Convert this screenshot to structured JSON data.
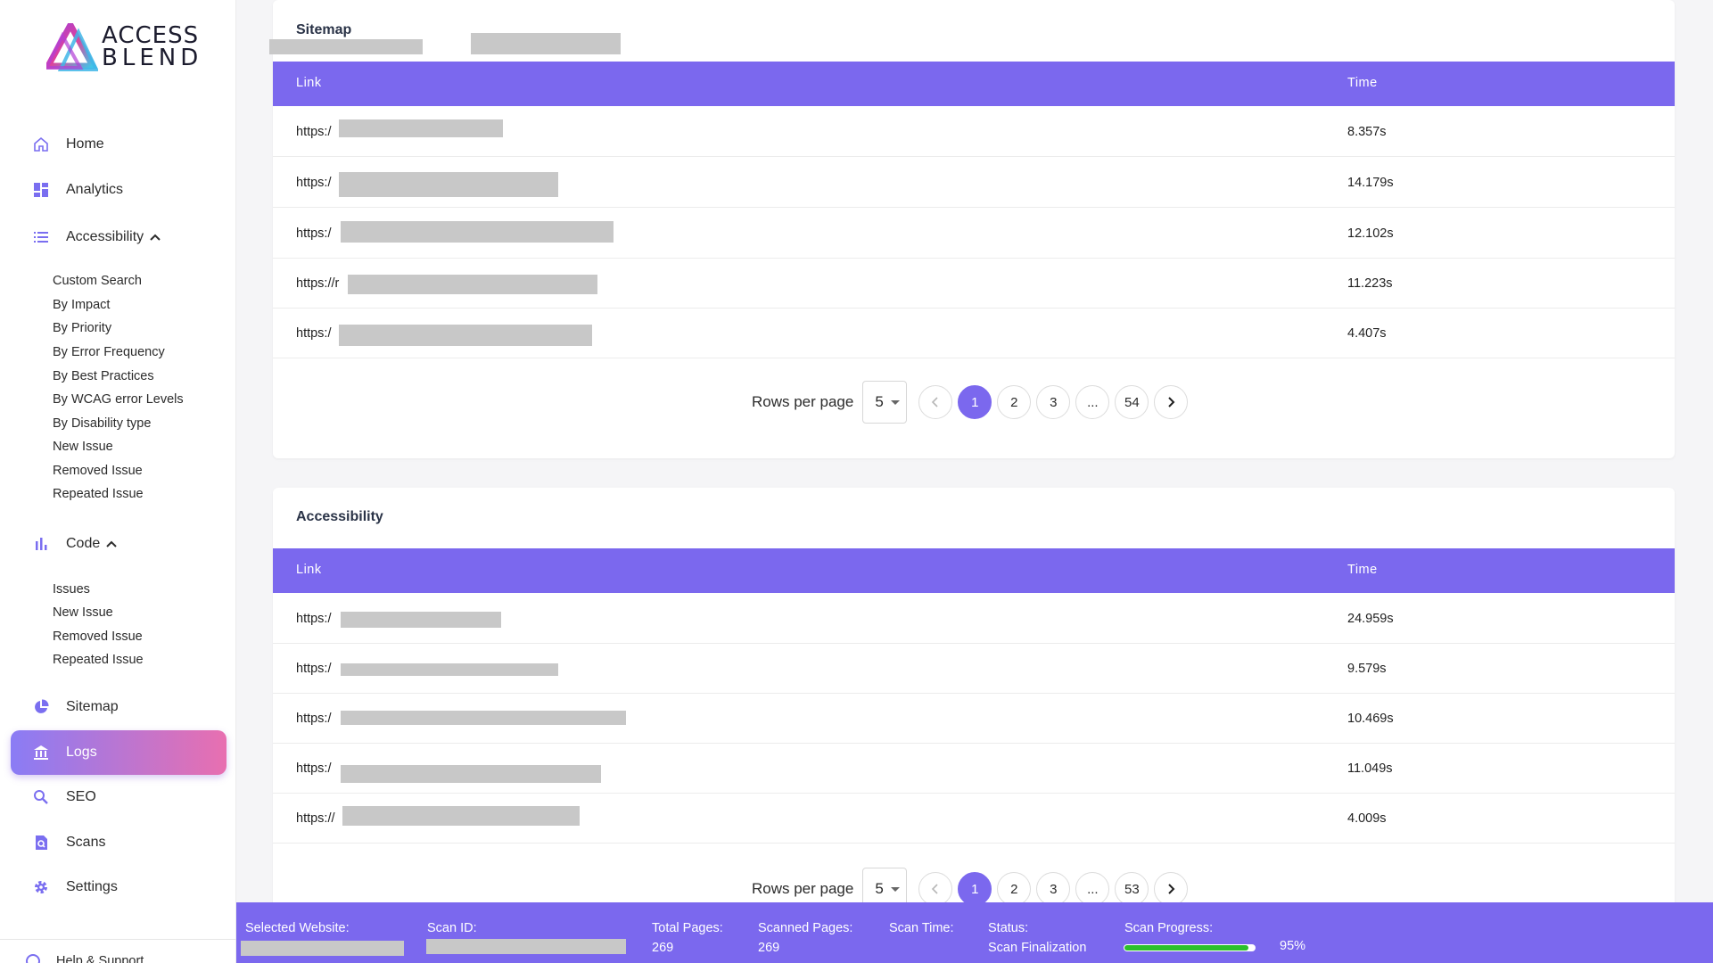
{
  "brand": {
    "line1": "ACCESS",
    "line2": "BLEND"
  },
  "nav": {
    "home": "Home",
    "analytics": "Analytics",
    "accessibility": "Accessibility",
    "accessibility_sub": [
      "Custom Search",
      "By Impact",
      "By Priority",
      "By Error Frequency",
      "By Best Practices",
      "By WCAG error Levels",
      "By Disability type",
      "New Issue",
      "Removed Issue",
      "Repeated Issue"
    ],
    "code": "Code",
    "code_sub": [
      "Issues",
      "New Issue",
      "Removed Issue",
      "Repeated Issue"
    ],
    "sitemap": "Sitemap",
    "logs": "Logs",
    "seo": "SEO",
    "scans": "Scans",
    "settings": "Settings",
    "help": "Help & Support"
  },
  "sitemap_table": {
    "title": "Sitemap",
    "columns": [
      "Link",
      "Time"
    ],
    "rows": [
      {
        "link": "https:/",
        "time": "8.357s"
      },
      {
        "link": "https:/",
        "time": "14.179s"
      },
      {
        "link": "https:/",
        "time": "12.102s"
      },
      {
        "link": "https://r",
        "time": "11.223s"
      },
      {
        "link": "https:/",
        "time": "4.407s"
      }
    ],
    "rows_per_page_label": "Rows per page",
    "rows_per_page": "5",
    "pages": [
      "1",
      "2",
      "3",
      "...",
      "54"
    ],
    "current_page": "1"
  },
  "accessibility_table": {
    "title": "Accessibility",
    "columns": [
      "Link",
      "Time"
    ],
    "rows": [
      {
        "link": "https:/",
        "time": "24.959s"
      },
      {
        "link": "https:/",
        "time": "9.579s"
      },
      {
        "link": "https:/",
        "time": "10.469s"
      },
      {
        "link": "https:/",
        "time": "11.049s"
      },
      {
        "link": "https://",
        "time": "4.009s"
      }
    ],
    "rows_per_page_label": "Rows per page",
    "rows_per_page": "5",
    "pages": [
      "1",
      "2",
      "3",
      "...",
      "53"
    ],
    "current_page": "1"
  },
  "status": {
    "selected_website_label": "Selected Website:",
    "scan_id_label": "Scan ID:",
    "total_pages_label": "Total Pages:",
    "total_pages": "269",
    "scanned_pages_label": "Scanned Pages:",
    "scanned_pages": "269",
    "scan_time_label": "Scan Time:",
    "status_label": "Status:",
    "status_value": "Scan Finalization",
    "scan_progress_label": "Scan Progress:",
    "scan_progress_text": "95%",
    "scan_progress": 0.95,
    "progress_color": "#2bc02b"
  },
  "colors": {
    "accent": "#7b68ee",
    "active_gradient_start": "#8a7cf5",
    "active_gradient_end": "#e86fb0"
  }
}
